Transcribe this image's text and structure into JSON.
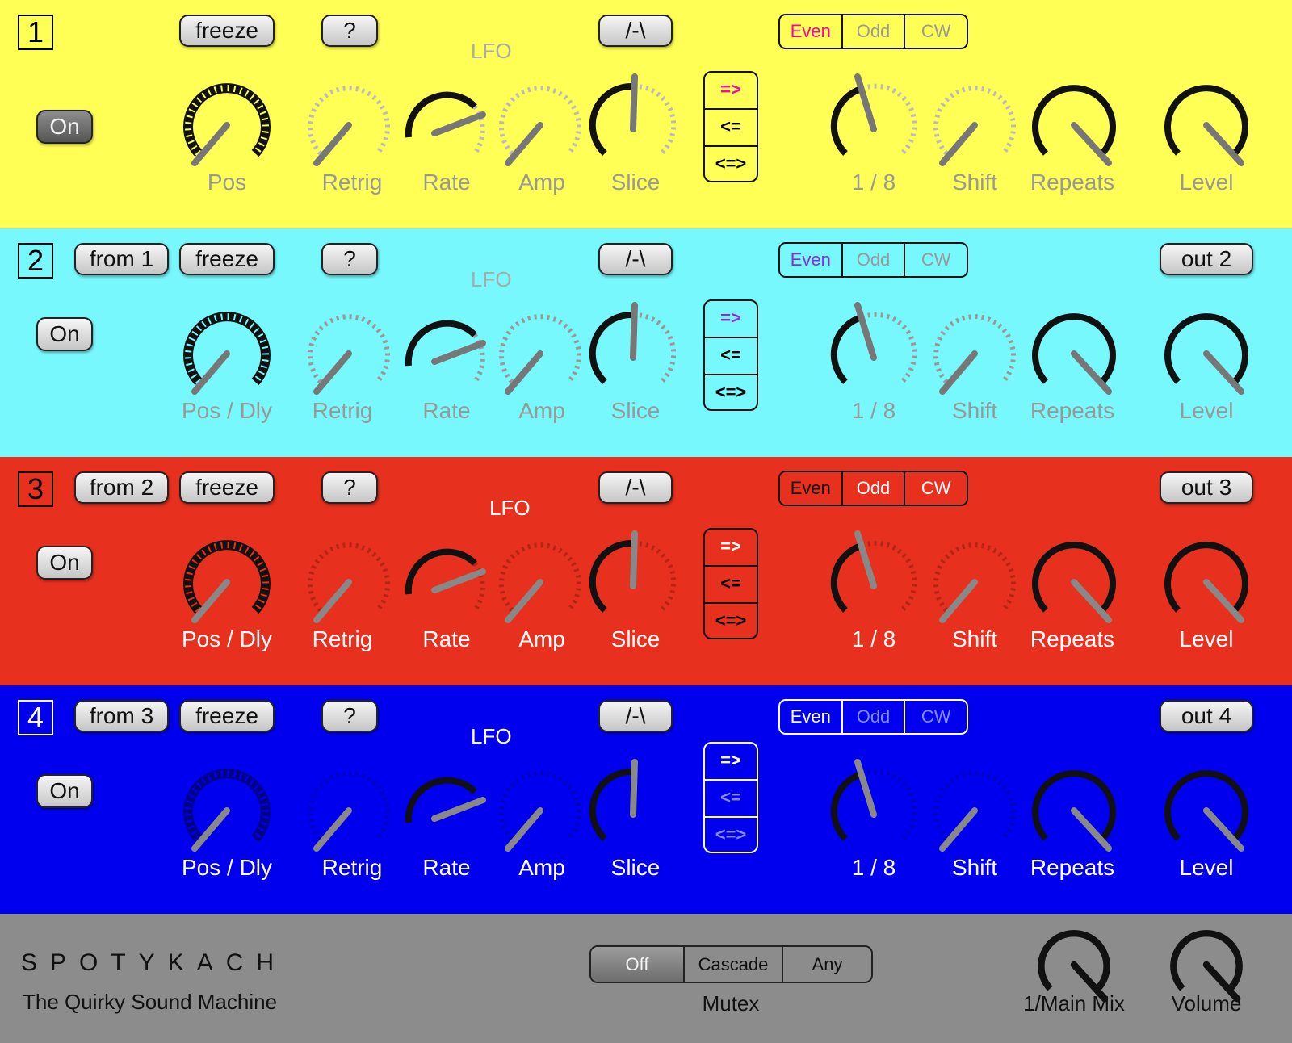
{
  "tracks": [
    {
      "number": "1",
      "from": null,
      "freeze": "freeze",
      "help": "?",
      "shape": "/-\\",
      "lfo": "LFO",
      "seg": [
        "Even",
        "Odd",
        "CW"
      ],
      "dir": [
        "=>",
        "<=",
        "<=>"
      ],
      "out": null,
      "on": "On",
      "labels": {
        "pos": "Pos",
        "retrig": "Retrig",
        "rate": "Rate",
        "amp": "Amp",
        "slice": "Slice",
        "div": "1 / 8",
        "shift": "Shift",
        "repeats": "Repeats",
        "level": "Level"
      }
    },
    {
      "number": "2",
      "from": "from 1",
      "freeze": "freeze",
      "help": "?",
      "shape": "/-\\",
      "lfo": "LFO",
      "seg": [
        "Even",
        "Odd",
        "CW"
      ],
      "dir": [
        "=>",
        "<=",
        "<=>"
      ],
      "out": "out 2",
      "on": "On",
      "labels": {
        "pos": "Pos / Dly",
        "retrig": "Retrig",
        "rate": "Rate",
        "amp": "Amp",
        "slice": "Slice",
        "div": "1 / 8",
        "shift": "Shift",
        "repeats": "Repeats",
        "level": "Level"
      }
    },
    {
      "number": "3",
      "from": "from 2",
      "freeze": "freeze",
      "help": "?",
      "shape": "/-\\",
      "lfo": "LFO",
      "seg": [
        "Even",
        "Odd",
        "CW"
      ],
      "dir": [
        "=>",
        "<=",
        "<=>"
      ],
      "out": "out 3",
      "on": "On",
      "labels": {
        "pos": "Pos / Dly",
        "retrig": "Retrig",
        "rate": "Rate",
        "amp": "Amp",
        "slice": "Slice",
        "div": "1 / 8",
        "shift": "Shift",
        "repeats": "Repeats",
        "level": "Level"
      }
    },
    {
      "number": "4",
      "from": "from 3",
      "freeze": "freeze",
      "help": "?",
      "shape": "/-\\",
      "lfo": "LFO",
      "seg": [
        "Even",
        "Odd",
        "CW"
      ],
      "dir": [
        "=>",
        "<=",
        "<=>"
      ],
      "out": "out 4",
      "on": "On",
      "labels": {
        "pos": "Pos / Dly",
        "retrig": "Retrig",
        "rate": "Rate",
        "amp": "Amp",
        "slice": "Slice",
        "div": "1 / 8",
        "shift": "Shift",
        "repeats": "Repeats",
        "level": "Level"
      }
    }
  ],
  "footer": {
    "brand": "SPOTYKACH",
    "tagline": "The Quirky Sound Machine",
    "mutex_options": [
      "Off",
      "Cascade",
      "Any"
    ],
    "mutex_selected": "Off",
    "mutex_label": "Mutex",
    "mainmix_label": "1/Main Mix",
    "volume_label": "Volume"
  },
  "colors": {
    "track1": "#ffff55",
    "track2": "#77f8fd",
    "track3": "#e8301f",
    "track4": "#0000ee",
    "footer": "#8c8c8c",
    "accent_even_track1": "#ff00aa",
    "accent_even_track2": "#8a2be2"
  },
  "icons": {
    "knob": "rotary-knob-icon"
  }
}
